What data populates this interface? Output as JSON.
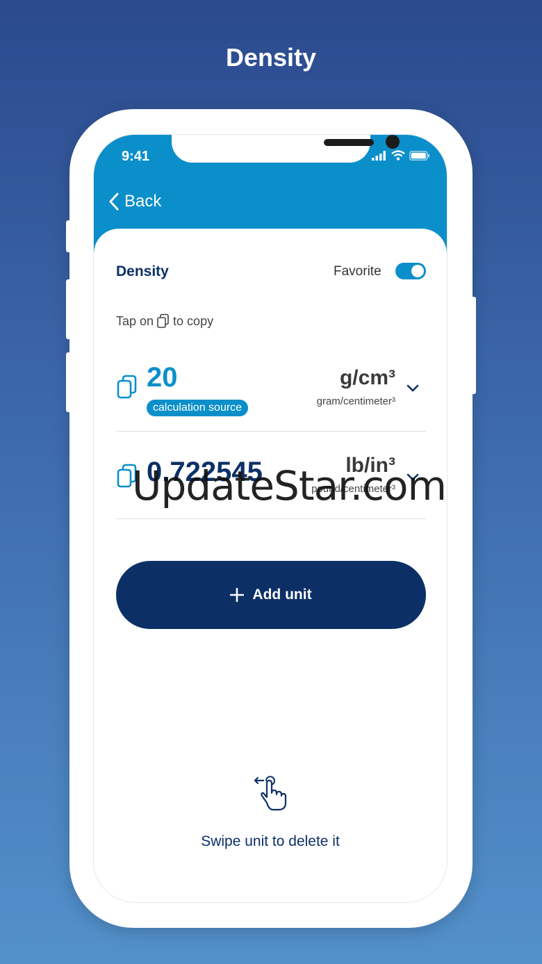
{
  "page": {
    "heading": "Density"
  },
  "status_bar": {
    "time": "9:41"
  },
  "nav": {
    "back_label": "Back"
  },
  "card": {
    "title": "Density",
    "favorite_label": "Favorite",
    "favorite_on": true,
    "hint_before": "Tap on",
    "hint_after": "to copy"
  },
  "units": [
    {
      "value": "20",
      "badge": "calculation source",
      "symbol": "g/cm³",
      "name": "gram/centimeter³",
      "value_color": "#0b8fca"
    },
    {
      "value": "0.722545",
      "symbol": "lb/in³",
      "name": "pound/centimeter³",
      "value_color": "#0c3066"
    }
  ],
  "add_button": {
    "label": "Add unit"
  },
  "swipe_hint": {
    "text": "Swipe unit to delete it"
  },
  "watermark": {
    "text": "UpdateStar.com"
  },
  "colors": {
    "accent": "#0b8fca",
    "navy": "#0c3066",
    "background_top": "#2b4a8e",
    "background_bottom": "#5391cb"
  }
}
